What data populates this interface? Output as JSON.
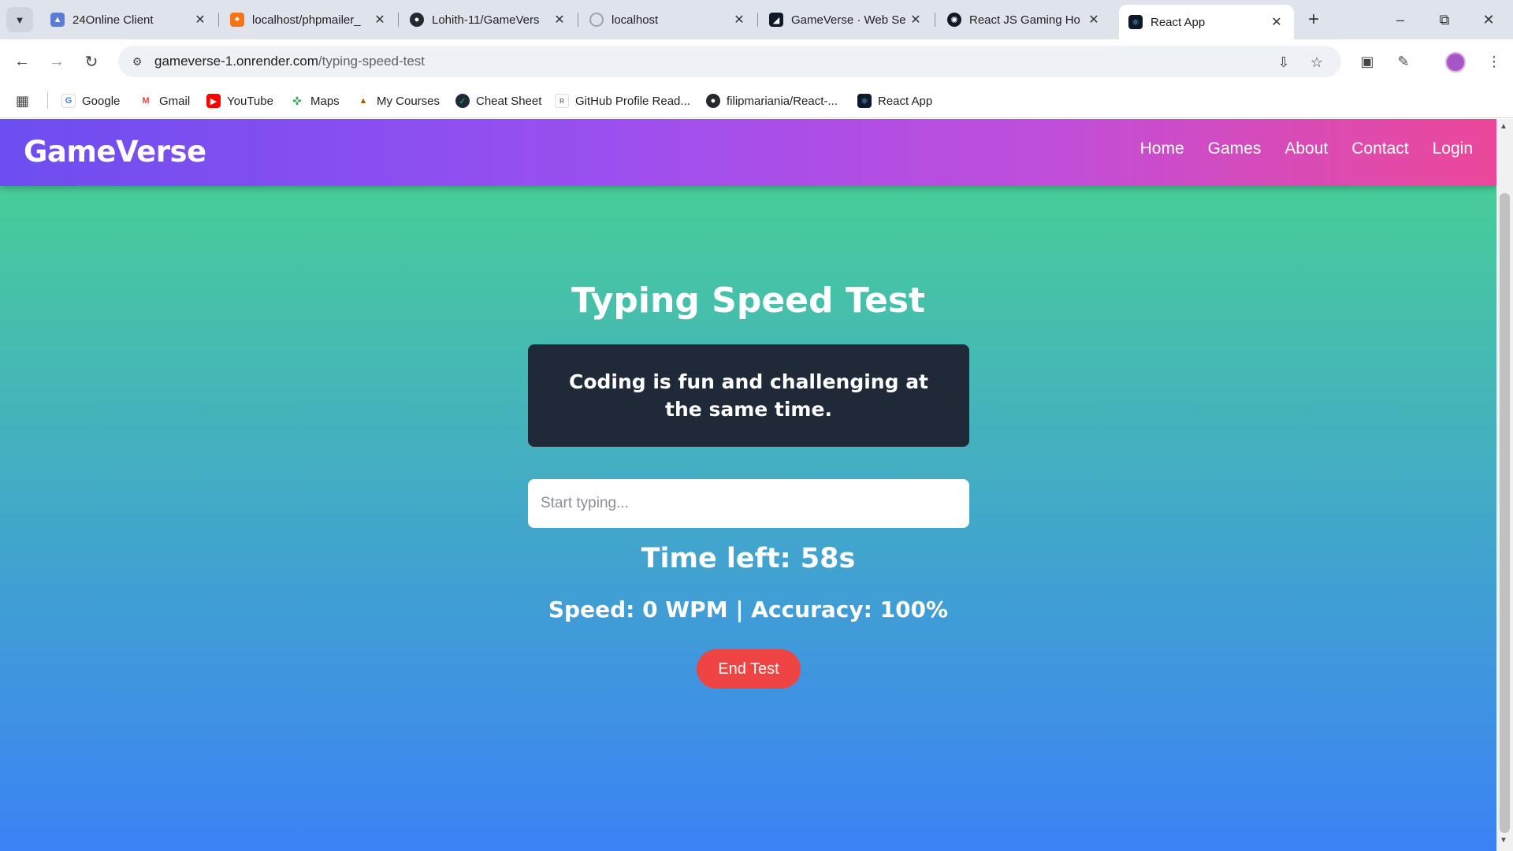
{
  "browser": {
    "tabs": [
      {
        "title": "24Online Client",
        "color": "#5b7bd5"
      },
      {
        "title": "localhost/phpmailer_",
        "color": "#f97316"
      },
      {
        "title": "Lohith-11/GameVers",
        "color": "#24292f"
      },
      {
        "title": "localhost",
        "color": "#9ca3af"
      },
      {
        "title": "GameVerse · Web Se",
        "color": "#111827"
      },
      {
        "title": "React JS Gaming Ho",
        "color": "#111827"
      },
      {
        "title": "React App",
        "color": "#0f172a"
      }
    ],
    "url_host": "gameverse-1.onrender.com",
    "url_path": "/typing-speed-test",
    "bookmarks": [
      {
        "label": "Google",
        "icon": "google-icon",
        "color": "#4285f4"
      },
      {
        "label": "Gmail",
        "icon": "gmail-icon",
        "color": "#ea4335"
      },
      {
        "label": "YouTube",
        "icon": "youtube-icon",
        "color": "#ff0000"
      },
      {
        "label": "Maps",
        "icon": "maps-icon",
        "color": "#34a853"
      },
      {
        "label": "My Courses",
        "icon": "courses-icon",
        "color": "#a16207"
      },
      {
        "label": "Cheat Sheet",
        "icon": "cheatsheet-icon",
        "color": "#1f2937"
      },
      {
        "label": "GitHub Profile Read...",
        "icon": "github-readme-icon",
        "color": "#6b7280"
      },
      {
        "label": "filipmariania/React-...",
        "icon": "github-icon",
        "color": "#24292f"
      },
      {
        "label": "React App",
        "icon": "react-icon",
        "color": "#0f172a"
      }
    ]
  },
  "app": {
    "brand": "GameVerse",
    "nav": [
      "Home",
      "Games",
      "About",
      "Contact",
      "Login"
    ],
    "heading": "Typing Speed Test",
    "quote": "Coding is fun and challenging at the same time.",
    "input_placeholder": "Start typing...",
    "time_left": "Time left: 58s",
    "stats": "Speed: 0 WPM | Accuracy: 100%",
    "end_button": "End Test"
  },
  "colors": {
    "navbar_start": "#6d4ef0",
    "navbar_end": "#ec4899",
    "bg_top": "#48d48f",
    "bg_bottom": "#3b82f6",
    "quote_bg": "#1f2937",
    "end_button": "#ef4444"
  }
}
